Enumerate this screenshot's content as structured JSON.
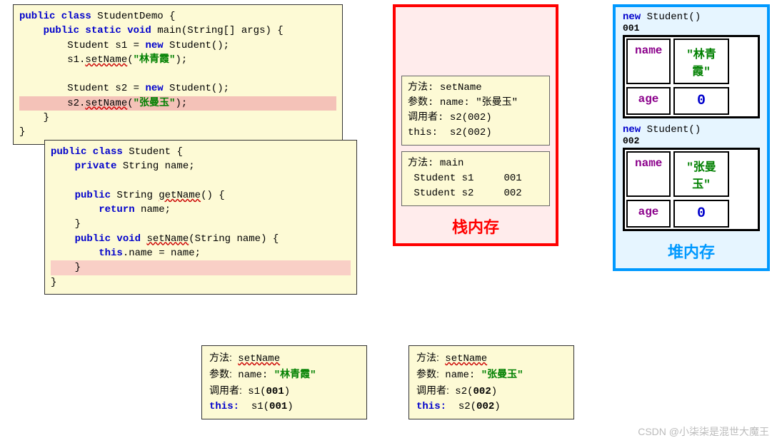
{
  "code1": {
    "lines": [
      {
        "raw": "public class StudentDemo {",
        "parts": [
          [
            "kw",
            "public class"
          ],
          [
            "",
            " StudentDemo {"
          ]
        ]
      },
      {
        "raw": "    public static void main(String[] args) {",
        "parts": [
          [
            "",
            "    "
          ],
          [
            "kw",
            "public static void"
          ],
          [
            "",
            " main(String[] args) {"
          ]
        ]
      },
      {
        "raw": "        Student s1 = new Student();",
        "parts": [
          [
            "",
            "        Student s1 = "
          ],
          [
            "kw",
            "new"
          ],
          [
            "",
            " Student();"
          ]
        ]
      },
      {
        "raw": "        s1.setName(\"林青霞\");",
        "parts": [
          [
            "",
            "        s1."
          ],
          [
            "wav",
            "setName"
          ],
          [
            "",
            "("
          ],
          [
            "str",
            "\"林青霞\""
          ],
          [
            "",
            ");"
          ]
        ]
      },
      {
        "raw": "",
        "parts": [
          [
            "",
            ""
          ]
        ]
      },
      {
        "raw": "        Student s2 = new Student();",
        "parts": [
          [
            "",
            "        Student s2 = "
          ],
          [
            "kw",
            "new"
          ],
          [
            "",
            " Student();"
          ]
        ]
      },
      {
        "raw": "        s2.setName(\"张曼玉\");",
        "hl": true,
        "parts": [
          [
            "",
            "        s2."
          ],
          [
            "wav",
            "setName"
          ],
          [
            "",
            "("
          ],
          [
            "str",
            "\"张曼玉\""
          ],
          [
            "",
            ");"
          ]
        ]
      },
      {
        "raw": "    }",
        "parts": [
          [
            "",
            "    }"
          ]
        ]
      },
      {
        "raw": "}",
        "parts": [
          [
            "",
            "}"
          ]
        ]
      }
    ]
  },
  "code2": {
    "lines": [
      {
        "raw": "public class Student {",
        "parts": [
          [
            "kw",
            "public class"
          ],
          [
            "",
            " Student {"
          ]
        ]
      },
      {
        "raw": "    private String name;",
        "parts": [
          [
            "",
            "    "
          ],
          [
            "kw",
            "private"
          ],
          [
            "",
            " String name;"
          ]
        ]
      },
      {
        "raw": "",
        "parts": [
          [
            "",
            ""
          ]
        ]
      },
      {
        "raw": "    public String getName() {",
        "parts": [
          [
            "",
            "    "
          ],
          [
            "kw",
            "public"
          ],
          [
            "",
            " String "
          ],
          [
            "wav",
            "getName"
          ],
          [
            "",
            "() {"
          ]
        ]
      },
      {
        "raw": "        return name;",
        "parts": [
          [
            "",
            "        "
          ],
          [
            "kw",
            "return"
          ],
          [
            "",
            " name;"
          ]
        ]
      },
      {
        "raw": "    }",
        "parts": [
          [
            "",
            "    }"
          ]
        ]
      },
      {
        "raw": "    public void setName(String name) {",
        "parts": [
          [
            "",
            "    "
          ],
          [
            "kw",
            "public void"
          ],
          [
            "",
            " "
          ],
          [
            "wav",
            "setName"
          ],
          [
            "",
            "(String name) {"
          ]
        ]
      },
      {
        "raw": "        this.name = name;",
        "parts": [
          [
            "",
            "        "
          ],
          [
            "kw",
            "this"
          ],
          [
            "",
            ".name = name;"
          ]
        ]
      },
      {
        "raw": "    }",
        "hl2": true,
        "parts": [
          [
            "",
            "    }"
          ]
        ]
      },
      {
        "raw": "}",
        "parts": [
          [
            "",
            "}"
          ]
        ]
      }
    ]
  },
  "stack": {
    "title": "栈内存",
    "frame1": {
      "method_lbl": "方法:",
      "method": "setName",
      "param_lbl": "参数:",
      "param_name": "name:",
      "param_val": "\"张曼玉\"",
      "caller_lbl": "调用者:",
      "caller": "s2(002)",
      "this_lbl": "this:",
      "this": "s2(002)"
    },
    "frame2": {
      "method_lbl": "方法:",
      "method": "main",
      "s1_lbl": "Student s1",
      "s1_addr": "001",
      "s2_lbl": "Student s2",
      "s2_addr": "002"
    }
  },
  "heap": {
    "title": "堆内存",
    "obj1": {
      "label_new": "new",
      "label_class": "Student()",
      "addr": "001",
      "name_key": "name",
      "name_val": "\"林青霞\"",
      "age_key": "age",
      "age_val": "0"
    },
    "obj2": {
      "label_new": "new",
      "label_class": "Student()",
      "addr": "002",
      "name_key": "name",
      "name_val": "\"张曼玉\"",
      "age_key": "age",
      "age_val": "0"
    }
  },
  "bottom_frame1": {
    "method_lbl": "方法:",
    "method": "setName",
    "param_lbl": "参数:",
    "param_name": "name:",
    "param_val": "\"林青霞\"",
    "caller_lbl": "调用者:",
    "caller": "s1(001)",
    "this_lbl": "this:",
    "this": "s1(001)"
  },
  "bottom_frame2": {
    "method_lbl": "方法:",
    "method": "setName",
    "param_lbl": "参数:",
    "param_name": "name:",
    "param_val": "\"张曼玉\"",
    "caller_lbl": "调用者:",
    "caller": "s2(002)",
    "this_lbl": "this:",
    "this": "s2(002)"
  },
  "watermark": "CSDN @小柒柒是混世大魔王"
}
